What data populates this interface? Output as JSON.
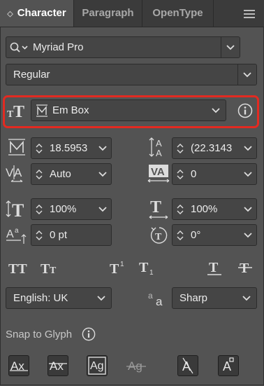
{
  "tabs": [
    {
      "label": "Character",
      "prefix": "◇"
    },
    {
      "label": "Paragraph"
    },
    {
      "label": "OpenType"
    }
  ],
  "font_family": "Myriad Pro",
  "font_style": "Regular",
  "alignment_reference": "Em Box",
  "font_size": "18.5953",
  "leading": "(22.3143",
  "kerning": "Auto",
  "tracking": "0",
  "vertical_scale": "100%",
  "horizontal_scale": "100%",
  "baseline_shift": "0 pt",
  "rotation": "0°",
  "language": "English: UK",
  "anti_aliasing": "Sharp",
  "snap_to_glyph_label": "Snap to Glyph",
  "colors": {
    "highlight": "#e32a21",
    "panel": "#535353",
    "tabbar": "#3b3b3b"
  }
}
